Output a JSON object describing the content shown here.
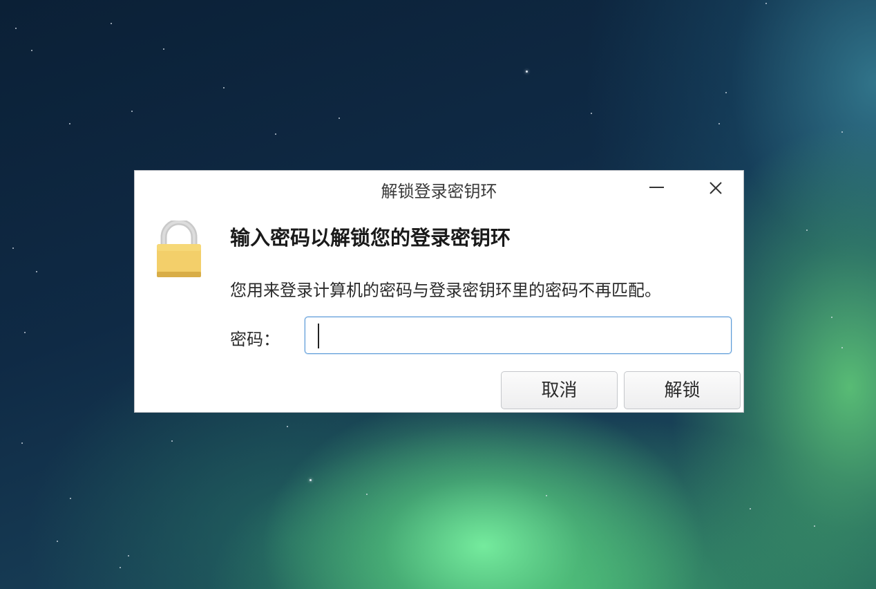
{
  "dialog": {
    "title": "解锁登录密钥环",
    "minimize_icon": "minimize-icon",
    "close_icon": "close-icon",
    "lock_icon": "padlock-icon",
    "heading": "输入密码以解锁您的登录密钥环",
    "message": "您用来登录计算机的密码与登录密钥环里的密码不再匹配。",
    "password_label": "密码：",
    "password_value": "",
    "cancel_label": "取消",
    "unlock_label": "解锁"
  },
  "colors": {
    "input_focus_border": "#5b9bd9",
    "lock_body": "#f3cf6a",
    "lock_shackle": "#c9c9c9"
  }
}
